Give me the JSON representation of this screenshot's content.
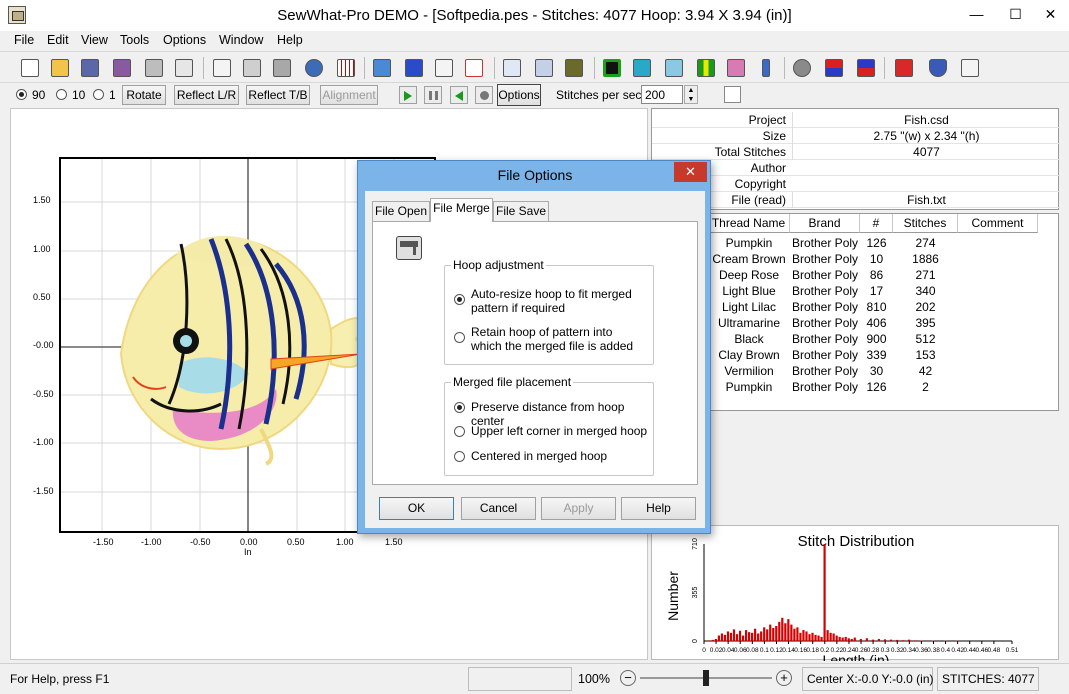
{
  "window": {
    "title": "SewWhat-Pro DEMO - [Softpedia.pes - Stitches: 4077  Hoop: 3.94 X 3.94 (in)]",
    "minimize": "—",
    "maximize": "☐",
    "close": "✕"
  },
  "menu": [
    "File",
    "Edit",
    "View",
    "Tools",
    "Options",
    "Window",
    "Help"
  ],
  "toolbar": {
    "icons": [
      "new-icon",
      "open-icon",
      "save-icon",
      "save-as-icon",
      "print-icon",
      "print-preview-icon",
      "cut-icon",
      "copy-icon",
      "paste-icon",
      "undo-icon",
      "grid-icon",
      "icons-icon",
      "b-icon",
      "text-icon",
      "abc-icon",
      "pages-icon",
      "d1-icon",
      "card-icon",
      "green-box-icon",
      "shirt-icon",
      "hoop-icon",
      "color-bars-icon",
      "flowers-icon",
      "needle-icon",
      "settings-icon",
      "colors-icon",
      "colors2-icon",
      "split-icon",
      "shield-icon",
      "help-cursor-icon"
    ]
  },
  "toolbar2": {
    "radio_90": "90",
    "radio_10": "10",
    "radio_1": "1",
    "rotate": "Rotate",
    "reflect_lr": "Reflect L/R",
    "reflect_tb": "Reflect T/B",
    "alignment": "Alignment",
    "options": "Options",
    "stitches_per_sec_label": "Stitches per sec",
    "stitches_per_sec_value": "200"
  },
  "plot": {
    "y_ticks": [
      "1.50",
      "1.00",
      "0.50",
      "-0.00",
      "-0.50",
      "-1.00",
      "-1.50"
    ],
    "x_ticks": [
      "-1.50",
      "-1.00",
      "-0.50",
      "0.00",
      "0.50",
      "1.00",
      "1.50"
    ],
    "x_unit": "In"
  },
  "info": {
    "rows": [
      {
        "key": "Project",
        "value": "Fish.csd"
      },
      {
        "key": "Size",
        "value": "2.75 \"(w) x 2.34 \"(h)"
      },
      {
        "key": "Total Stitches",
        "value": "4077"
      },
      {
        "key": "Author",
        "value": ""
      },
      {
        "key": "Copyright",
        "value": ""
      },
      {
        "key": "File (read)",
        "value": "Fish.txt"
      }
    ]
  },
  "threads": {
    "headers": [
      "Thread Name",
      "Brand",
      "#",
      "Stitches",
      "Comment"
    ],
    "rows": [
      {
        "name": "Pumpkin",
        "brand": "Brother Poly",
        "num": "126",
        "stitches": "274",
        "color": "#f5a623"
      },
      {
        "name": "Cream Brown",
        "brand": "Brother Poly",
        "num": "10",
        "stitches": "1886",
        "color": "#f2e8a8"
      },
      {
        "name": "Deep Rose",
        "brand": "Brother Poly",
        "num": "86",
        "stitches": "271",
        "color": "#e87aa8"
      },
      {
        "name": "Light Blue",
        "brand": "Brother Poly",
        "num": "17",
        "stitches": "340",
        "color": "#a9dce8"
      },
      {
        "name": "Light Lilac",
        "brand": "Brother Poly",
        "num": "810",
        "stitches": "202",
        "color": "#e9b8e0"
      },
      {
        "name": "Ultramarine",
        "brand": "Brother Poly",
        "num": "406",
        "stitches": "395",
        "color": "#243c9c"
      },
      {
        "name": "Black",
        "brand": "Brother Poly",
        "num": "900",
        "stitches": "512",
        "color": "#111111"
      },
      {
        "name": "Clay Brown",
        "brand": "Brother Poly",
        "num": "339",
        "stitches": "153",
        "color": "#a0684a"
      },
      {
        "name": "Vermilion",
        "brand": "Brother Poly",
        "num": "30",
        "stitches": "42",
        "color": "#e4411c"
      },
      {
        "name": "Pumpkin",
        "brand": "Brother Poly",
        "num": "126",
        "stitches": "2",
        "color": "#f5a623"
      }
    ]
  },
  "distribution": {
    "title": "Stitch Distribution",
    "ylabel": "Number",
    "xlabel": "Length (in)",
    "y_ticks": [
      "710",
      "355",
      "0"
    ],
    "x_ticks": [
      "0",
      "0.02",
      "0.04",
      "0.06",
      "0.08",
      "0.1",
      "0.12",
      "0.14",
      "0.16",
      "0.18",
      "0.2",
      "0.22",
      "0.24",
      "0.26",
      "0.28",
      "0.3",
      "0.32",
      "0.34",
      "0.36",
      "0.38",
      "0.4",
      "0.42",
      "0.44",
      "0.46",
      "0.48",
      "0.51"
    ]
  },
  "chart_data": {
    "type": "bar",
    "title": "Stitch Distribution",
    "xlabel": "Length (in)",
    "ylabel": "Number",
    "ylim": [
      0,
      710
    ],
    "xlim": [
      0,
      0.51
    ],
    "x": [
      0.01,
      0.015,
      0.02,
      0.025,
      0.03,
      0.035,
      0.04,
      0.045,
      0.05,
      0.055,
      0.06,
      0.065,
      0.07,
      0.075,
      0.08,
      0.085,
      0.09,
      0.095,
      0.1,
      0.105,
      0.11,
      0.115,
      0.12,
      0.125,
      0.13,
      0.135,
      0.14,
      0.145,
      0.15,
      0.155,
      0.16,
      0.165,
      0.17,
      0.175,
      0.18,
      0.185,
      0.19,
      0.195,
      0.2,
      0.205,
      0.21,
      0.215,
      0.22,
      0.225,
      0.23,
      0.235,
      0.24,
      0.245,
      0.25,
      0.26,
      0.27,
      0.28,
      0.29,
      0.3,
      0.31,
      0.32,
      0.33,
      0.34,
      0.35,
      0.36,
      0.38,
      0.4,
      0.42
    ],
    "values": [
      5,
      8,
      15,
      40,
      55,
      45,
      70,
      60,
      85,
      50,
      75,
      40,
      80,
      65,
      60,
      90,
      55,
      70,
      100,
      85,
      120,
      95,
      110,
      140,
      170,
      130,
      160,
      120,
      90,
      100,
      60,
      80,
      70,
      50,
      60,
      45,
      40,
      30,
      710,
      80,
      60,
      55,
      40,
      30,
      25,
      30,
      20,
      15,
      25,
      15,
      20,
      10,
      15,
      12,
      10,
      8,
      6,
      10,
      5,
      4,
      3,
      3,
      2
    ],
    "color": "#d40000"
  },
  "dialog": {
    "title": "File Options",
    "close": "✕",
    "tabs": [
      "File Open",
      "File Merge",
      "File Save"
    ],
    "hoop_group": "Hoop adjustment",
    "hoop_opt1": "Auto-resize hoop to fit merged pattern if required",
    "hoop_opt2": "Retain hoop of pattern into which the merged file is added",
    "placement_group": "Merged file placement",
    "place_opt1": "Preserve distance from hoop center",
    "place_opt2": "Upper left corner in merged hoop",
    "place_opt3": "Centered in merged hoop",
    "ok": "OK",
    "cancel": "Cancel",
    "apply": "Apply",
    "help": "Help"
  },
  "status": {
    "help": "For Help, press F1",
    "zoom": "100%",
    "center": "Center X:-0.0 Y:-0.0 (in)",
    "stitches": "STITCHES:  4077"
  }
}
